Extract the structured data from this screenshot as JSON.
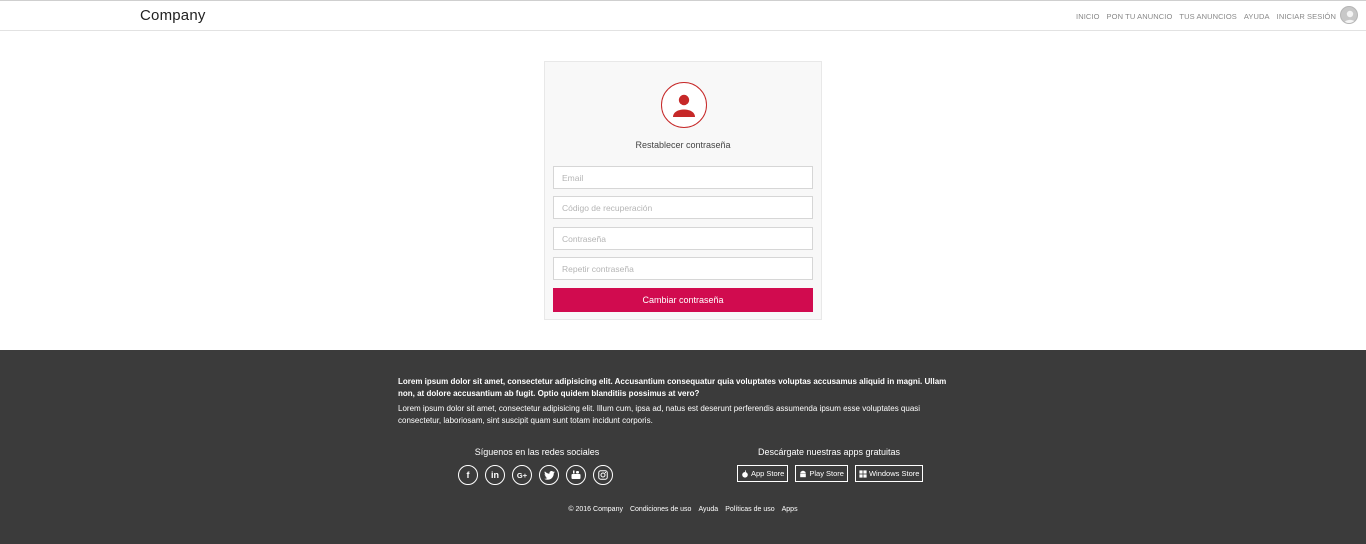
{
  "header": {
    "brand": "Company",
    "nav": [
      "INICIO",
      "PON TU ANUNCIO",
      "TUS ANUNCIOS",
      "AYUDA",
      "INICIAR SESIÓN"
    ]
  },
  "form": {
    "title": "Restablecer contraseña",
    "email_placeholder": "Email",
    "code_placeholder": "Código de recuperación",
    "password_placeholder": "Contraseña",
    "repeat_placeholder": "Repetir contraseña",
    "submit_label": "Cambiar contraseña"
  },
  "footer": {
    "lead": "Lorem ipsum dolor sit amet, consectetur adipisicing elit. Accusantium consequatur quia voluptates voluptas accusamus aliquid in magni. Ullam non, at dolore accusantium ab fugit. Optio quidem blanditiis possimus at vero?",
    "body": "Lorem ipsum dolor sit amet, consectetur adipisicing elit. Illum cum, ipsa ad, natus est deserunt perferendis assumenda ipsum esse voluptates quasi consectetur, laboriosam, sint suscipit quam sunt totam incidunt corporis.",
    "social_title": "Síguenos en las redes sociales",
    "social_icons": [
      "facebook-icon",
      "linkedin-icon",
      "google-plus-icon",
      "twitter-icon",
      "youtube-icon",
      "instagram-icon"
    ],
    "apps_title": "Descárgate nuestras apps gratuitas",
    "apps": [
      "App Store",
      "Play Store",
      "Windows Store"
    ],
    "links": [
      "© 2016 Company",
      "Condiciones de uso",
      "Ayuda",
      "Políticas de uso",
      "Apps"
    ]
  },
  "colors": {
    "accent": "#d10b4f",
    "icon_red": "#c62828",
    "footer_bg": "#3b3b3b"
  }
}
